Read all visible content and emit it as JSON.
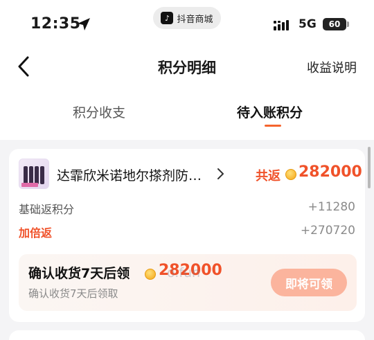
{
  "status_bar": {
    "time": "12:35",
    "app_pill": "抖音商城",
    "network": "5G",
    "battery": "60"
  },
  "nav": {
    "title": "积分明细",
    "right_link": "收益说明"
  },
  "tabs": [
    {
      "label": "积分收支",
      "active": false
    },
    {
      "label": "待入账积分",
      "active": true
    }
  ],
  "order": {
    "product_name": "达霏欣米诺地尔搽剂防…",
    "return_label": "共返",
    "return_value": "282000",
    "rows": [
      {
        "label": "基础返积分",
        "value": "+11280"
      },
      {
        "label": "加倍返",
        "value": "+270720"
      }
    ],
    "confirm": {
      "title": "确认收货7天后领",
      "amount": "282000",
      "subtitle": "确认收货7天后领取",
      "button": "即将可领",
      "watermark": "o.fun"
    }
  },
  "colors": {
    "accent": "#f0522a",
    "tab_indicator": "#f5642d",
    "button_disabled": "#fbb49d"
  }
}
